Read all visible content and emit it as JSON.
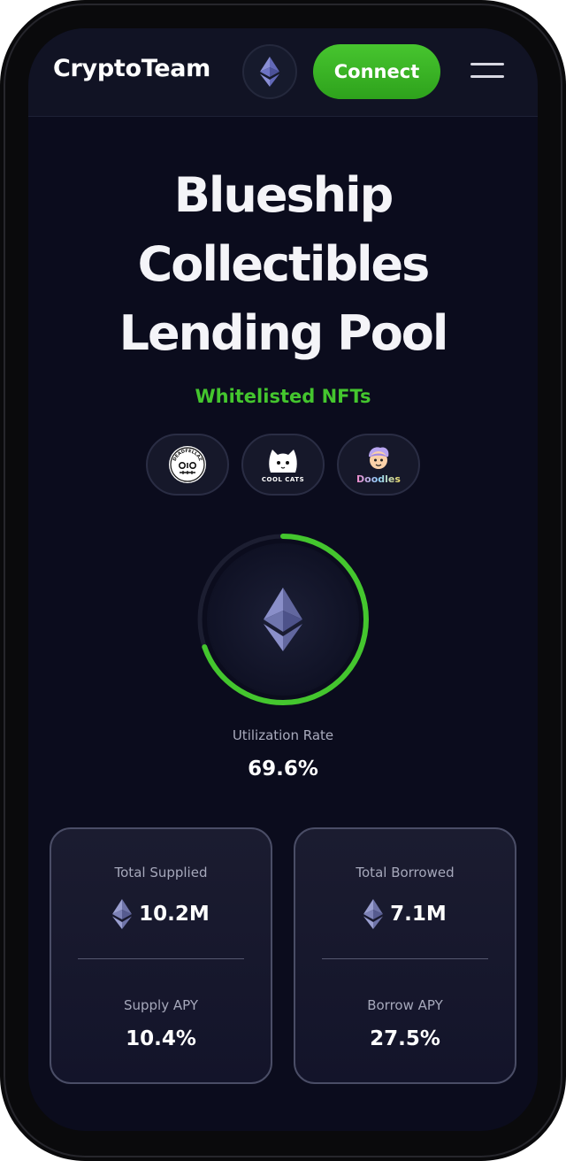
{
  "header": {
    "brand": "CryptoTeam",
    "network_icon": "ethereum-icon",
    "connect_label": "Connect",
    "menu_icon": "hamburger-menu-icon"
  },
  "hero": {
    "title_lines": [
      "Blueship",
      "Collectibles",
      "Lending Pool"
    ],
    "subtitle": "Whitelisted NFTs"
  },
  "nfts": [
    {
      "label": "DEADFELLAZ",
      "icon": "deadfellaz-logo"
    },
    {
      "label": "COOL CATS",
      "icon": "cool-cats-logo"
    },
    {
      "label": "Doodles",
      "icon": "doodles-logo"
    }
  ],
  "utilization": {
    "label": "Utilization Rate",
    "value_text": "69.6%",
    "fraction": 0.696
  },
  "stats": {
    "supplied": {
      "title": "Total Supplied",
      "value": "10.2M",
      "apy_title": "Supply APY",
      "apy_value": "10.4%"
    },
    "borrowed": {
      "title": "Total Borrowed",
      "value": "7.1M",
      "apy_title": "Borrow APY",
      "apy_value": "27.5%"
    }
  },
  "colors": {
    "accent_green": "#44c62e",
    "background": "#0b0c1d",
    "card_border": "#4a4d66"
  }
}
